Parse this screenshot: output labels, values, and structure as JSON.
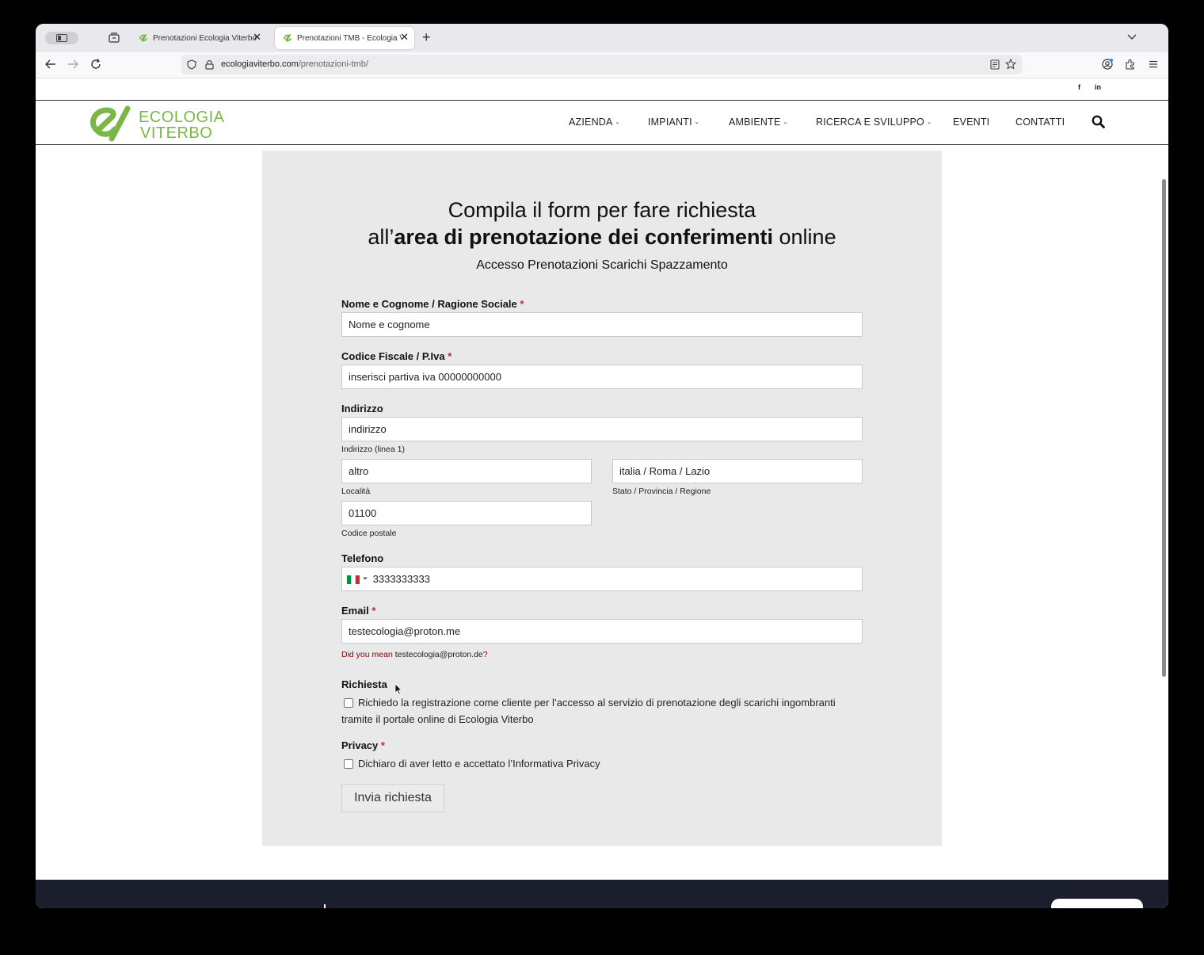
{
  "browser": {
    "tabs": [
      {
        "title": "Prenotazioni Ecologia Viterbo | E",
        "active": false
      },
      {
        "title": "Prenotazioni TMB - Ecologia Vit",
        "active": true
      }
    ],
    "close_glyph": "✕",
    "new_tab_glyph": "+",
    "url_domain": "ecologiaviterbo.com",
    "url_path": "/prenotazioni-tmb/"
  },
  "site": {
    "social": {
      "facebook": "f",
      "linkedin": "in"
    },
    "logo": {
      "line1": "ECOLOGIA",
      "line2": "VITERBO",
      "brand_color": "#7ab648"
    },
    "menu": [
      {
        "label": "AZIENDA",
        "dropdown": true
      },
      {
        "label": "IMPIANTI",
        "dropdown": true
      },
      {
        "label": "AMBIENTE",
        "dropdown": true
      },
      {
        "label": "RICERCA E SVILUPPO",
        "dropdown": true
      },
      {
        "label": "EVENTI",
        "dropdown": false
      },
      {
        "label": "CONTATTI",
        "dropdown": false
      }
    ],
    "dropdown_glyph": "⌄"
  },
  "form": {
    "headline_line1": "Compila il form per fare richiesta",
    "headline_prefix": "all’",
    "headline_bold": "area di prenotazione dei conferimenti",
    "headline_suffix": " online",
    "subheading": "Accesso Prenotazioni Scarichi Spazzamento",
    "required_marker": "*",
    "name_label": "Nome e Cognome / Ragione Sociale",
    "name_value": "Nome e cognome",
    "tax_label": "Codice Fiscale / P.Iva",
    "tax_value": "inserisci partiva iva 00000000000",
    "address_label": "Indirizzo",
    "address_line1_value": "indirizzo",
    "address_line1_sub": "Indirizzo (linea 1)",
    "city_value": "altro",
    "city_sub": "Località",
    "region_value": "italia / Roma / Lazio",
    "region_sub": "Stato / Provincia / Regione",
    "postal_value": "01100",
    "postal_sub": "Codice postale",
    "phone_label": "Telefono",
    "phone_value": "3333333333",
    "email_label": "Email",
    "email_value": "testecologia@proton.me",
    "suggestion_prefix": "Did you mean ",
    "suggestion_email": "testecologia@proton.de",
    "suggestion_suffix": "?",
    "request_label": "Richiesta",
    "request_line1": "Richiedo la registrazione come cliente per l’accesso al servizio di prenotazione degli scarichi ingombranti",
    "request_line2": "tramite il portale online di Ecologia Viterbo",
    "request_checked": false,
    "privacy_label": "Privacy",
    "privacy_text": "Dichiaro di aver letto e accettato l’Informativa Privacy",
    "privacy_checked": false,
    "submit_label": "Invia richiesta"
  }
}
